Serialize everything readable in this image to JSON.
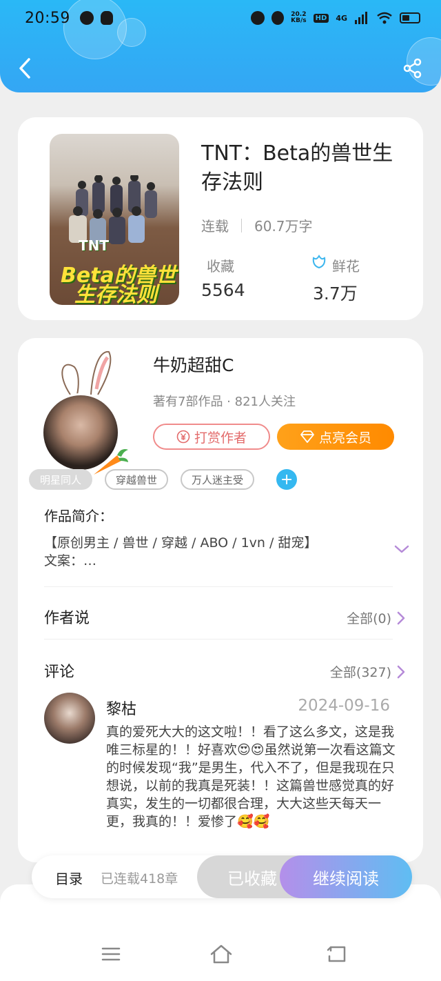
{
  "status_bar": {
    "time": "20:59",
    "net_speed_top": "20.2",
    "net_speed_bottom": "KB/s",
    "hd_badge": "HD",
    "network": "4G"
  },
  "book": {
    "title": "TNT：Beta的兽世生存法则",
    "status": "连载",
    "word_count": "60.7万字",
    "favorites_label": "收藏",
    "favorites_value": "5564",
    "flowers_label": "鲜花",
    "flowers_value": "3.7万",
    "cover_text_tnt": "TNT",
    "cover_text_line1": "Beta的兽世",
    "cover_text_line2": "生存法则"
  },
  "author": {
    "name": "牛奶超甜C",
    "meta": "著有7部作品 · 821人关注",
    "reward_button": "打赏作者",
    "vip_button": "点亮会员"
  },
  "tags": [
    "明星同人",
    "穿越兽世",
    "万人迷主受"
  ],
  "intro": {
    "title": "作品简介：",
    "line1": "【原创男主 / 兽世 / 穿越 / ABO / 1vn / 甜宠】",
    "line2": "文案：…"
  },
  "author_says": {
    "title": "作者说",
    "link": "全部(0)"
  },
  "comments": {
    "title": "评论",
    "link": "全部(327)",
    "items": [
      {
        "user": "黎枯",
        "date": "2024-09-16",
        "text": "真的爱死大大的这文啦！！看了这么多文，这是我唯三标星的！！好喜欢😍😍虽然说第一次看这篇文的时候发现“我”是男生，代入不了，但是我现在只想说，以前的我真是死装！！这篇兽世感觉真的好真实，发生的一切都很合理，大大这些天每天一更，我真的！！爱惨了🥰🥰"
      }
    ]
  },
  "action_bar": {
    "toc": "目录",
    "chapters": "已连载418章",
    "collected": "已收藏",
    "continue": "继续阅读"
  },
  "colors": {
    "header": "#2ab8f6",
    "accent_orange": "#ff8a00",
    "reward_red": "#e36b6b"
  }
}
